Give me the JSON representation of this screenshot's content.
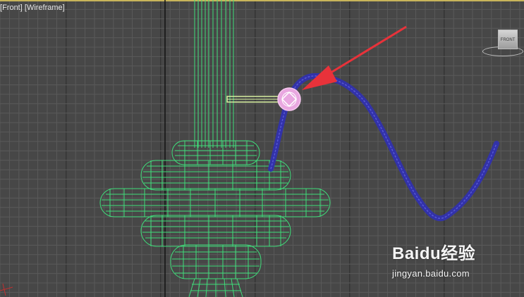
{
  "viewport": {
    "label_view": "Front",
    "label_mode": "Wireframe",
    "viewcube_face": "FRONT"
  },
  "colors": {
    "background": "#474747",
    "grid_minor": "#5a5a5a",
    "grid_major": "#2c2c2c",
    "top_border": "#c8b45a",
    "green_wireframe": "#3fdc7a",
    "blue_spline": "#3232a8",
    "pink_gizmo": "#f5a8e8",
    "arrow_red": "#e8323a",
    "helper_box": "#d8f0a0"
  },
  "watermark": {
    "brand": "Baidu经验",
    "url": "jingyan.baidu.com"
  }
}
